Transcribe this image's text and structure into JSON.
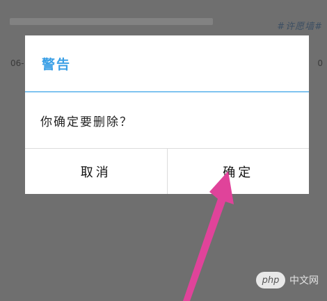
{
  "background": {
    "tag": "#许愿墙#",
    "date_fragment": "06-",
    "right_fragment": "0"
  },
  "dialog": {
    "title": "警告",
    "message": "你确定要删除？",
    "cancel_label": "取消",
    "confirm_label": "确定"
  },
  "watermark": {
    "badge": "php",
    "text": "中文网"
  },
  "colors": {
    "title_accent": "#3ba0e6",
    "arrow": "#e0439a",
    "overlay": "#6f6f6f"
  }
}
